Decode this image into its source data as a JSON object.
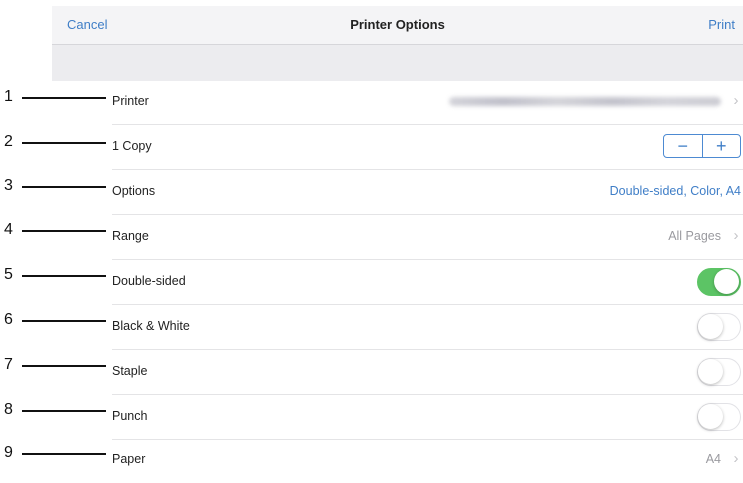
{
  "navbar": {
    "cancel_label": "Cancel",
    "title": "Printer Options",
    "print_label": "Print"
  },
  "rows": [
    {
      "number": "1",
      "label": "Printer",
      "value": ""
    },
    {
      "number": "2",
      "label": "1 Copy",
      "stepper": {
        "minus": "−",
        "plus": "+"
      }
    },
    {
      "number": "3",
      "label": "Options",
      "value": "Double-sided, Color, A4"
    },
    {
      "number": "4",
      "label": "Range",
      "value": "All Pages"
    },
    {
      "number": "5",
      "label": "Double-sided",
      "toggle_on": true
    },
    {
      "number": "6",
      "label": "Black & White",
      "toggle_on": false
    },
    {
      "number": "7",
      "label": "Staple",
      "toggle_on": false
    },
    {
      "number": "8",
      "label": "Punch",
      "toggle_on": false
    },
    {
      "number": "9",
      "label": "Paper",
      "value": "A4"
    }
  ],
  "icons": {
    "chevron": "chevron-right-icon"
  },
  "colors": {
    "accent": "#3f7ec7",
    "toggle_on": "#5cc465"
  }
}
